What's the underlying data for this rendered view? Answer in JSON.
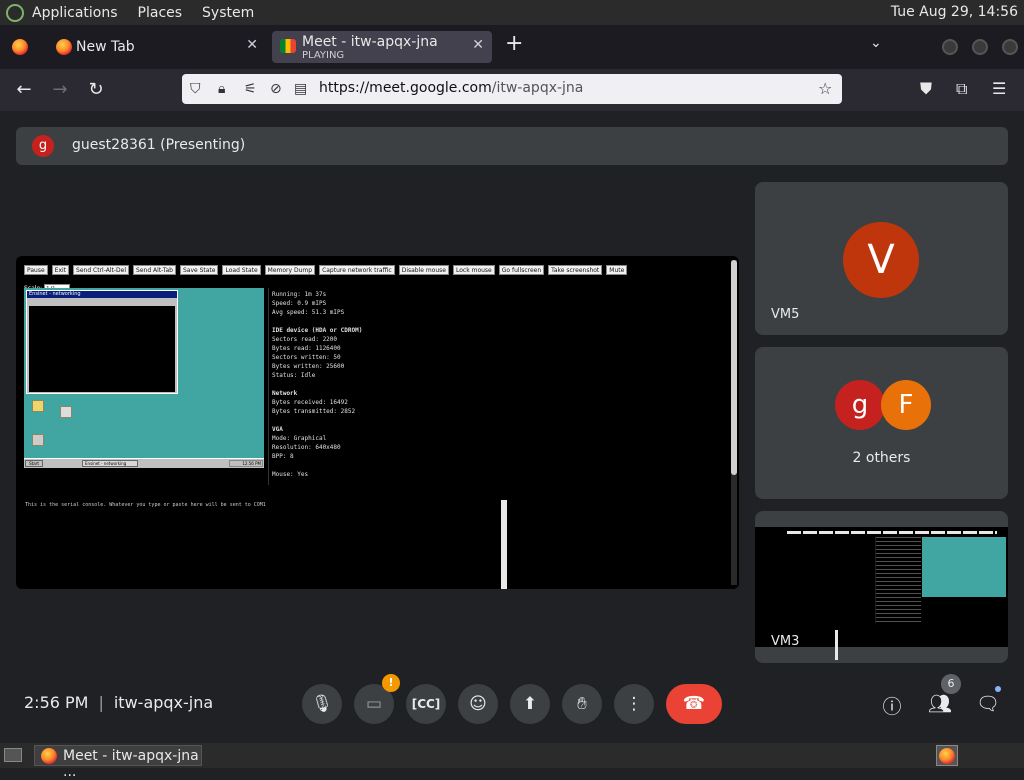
{
  "top_panel": {
    "menus": [
      "Applications",
      "Places",
      "System"
    ],
    "clock": "Tue Aug 29, 14:56"
  },
  "browser": {
    "tabs": [
      {
        "title": "New Tab"
      },
      {
        "title": "Meet - itw-apqx-jna",
        "subtitle": "PLAYING"
      }
    ],
    "url_host": "https://meet.google.com",
    "url_path": "/itw-apqx-jna"
  },
  "meet": {
    "presenter": {
      "initial": "g",
      "label": "guest28361 (Presenting)"
    },
    "shared_screen": {
      "toolbar_buttons": [
        "Pause",
        "Exit",
        "Send Ctrl-Alt-Del",
        "Send Alt-Tab",
        "Save State",
        "Load State",
        "Memory Dump",
        "Capture network traffic",
        "Disable mouse",
        "Lock mouse",
        "Go fullscreen",
        "Take screenshot",
        "Mute"
      ],
      "scale_label": "Scale:",
      "scale_value": "1.0",
      "vm_window_title": "Ensinet - networking",
      "vm_taskbar": {
        "start": "Start",
        "task": "Ensinet - networking",
        "tray": "12:56 PM"
      },
      "stats": {
        "running": "Running: 1m 37s",
        "speed": "Speed: 0.9 mIPS",
        "avg_speed": "Avg speed: 51.3 mIPS",
        "ide_header": "IDE device (HDA or CDROM)",
        "sectors_read": "Sectors read: 2200",
        "bytes_read": "Bytes read: 1126400",
        "sectors_written": "Sectors written: 50",
        "bytes_written": "Bytes written: 25600",
        "ide_status": "Status: Idle",
        "network_header": "Network",
        "bytes_received": "Bytes received: 16492",
        "bytes_transmitted": "Bytes transmitted: 2852",
        "vga_header": "VGA",
        "vga_mode": "Mode: Graphical",
        "vga_resolution": "Resolution: 640x480",
        "vga_bpp": "BPP: 8",
        "mouse": "Mouse: Yes"
      },
      "serial_text": "This is the serial console. Whatever you type or paste here will be sent to COM1"
    },
    "participants": [
      {
        "name": "VM5",
        "initial": "V",
        "color": "#bf360c"
      },
      {
        "label": "2 others",
        "initials": [
          "g",
          "F"
        ],
        "colors": [
          "#c5221f",
          "#e8710a"
        ]
      },
      {
        "name": "VM3"
      }
    ],
    "meeting_info": {
      "time": "2:56 PM",
      "code": "itw-apqx-jna"
    },
    "controls": {
      "camera_warning": "!",
      "participants_count": "6"
    }
  },
  "bottom_panel": {
    "task_label": "Meet - itw-apqx-jna ..."
  },
  "colors": {
    "meet_bg": "#202124",
    "tile_bg": "#3c4043",
    "leave_red": "#ea4335",
    "warn_orange": "#f29900"
  }
}
